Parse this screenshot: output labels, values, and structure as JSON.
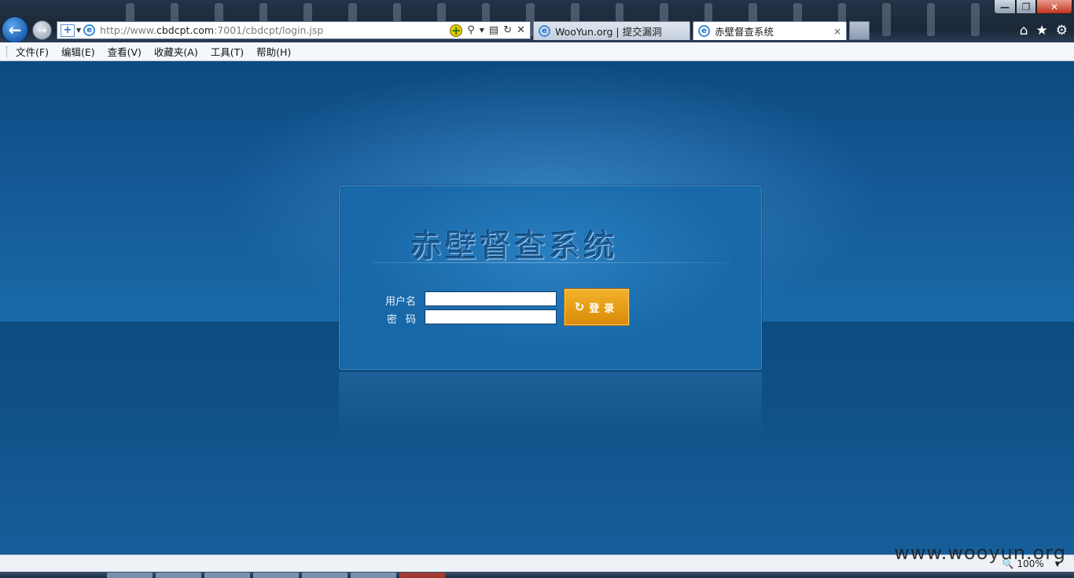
{
  "browser": {
    "address_url_prefix": "http://www.",
    "address_url_domain": "cbdcpt.com",
    "address_url_rest": ":7001/cbdcpt/login.jsp",
    "tabs": [
      {
        "label": "WooYun.org | 提交漏洞",
        "active": false
      },
      {
        "label": "赤壁督查系统",
        "active": true
      }
    ],
    "tab_close_glyph": "×"
  },
  "menubar": {
    "items": [
      "文件(F)",
      "编辑(E)",
      "查看(V)",
      "收藏夹(A)",
      "工具(T)",
      "帮助(H)"
    ]
  },
  "login": {
    "system_title": "赤壁督查系统",
    "username_label": "用户名",
    "password_label": "密码",
    "username_value": "",
    "password_value": "",
    "submit_label": "登录"
  },
  "statusbar": {
    "zoom": "100%"
  },
  "watermark": "www.wooyun.org",
  "colors": {
    "page_background": "#0f4a7f",
    "login_button": "#e59a10",
    "panel": "#1a6aa8"
  },
  "icons": [
    "back-arrow-icon",
    "forward-arrow-icon",
    "compat-view-icon",
    "ie-logo-icon",
    "add-icon",
    "search-icon",
    "refresh-icon",
    "stop-icon",
    "home-icon",
    "favorites-star-icon",
    "settings-gear-icon",
    "zoom-icon"
  ]
}
